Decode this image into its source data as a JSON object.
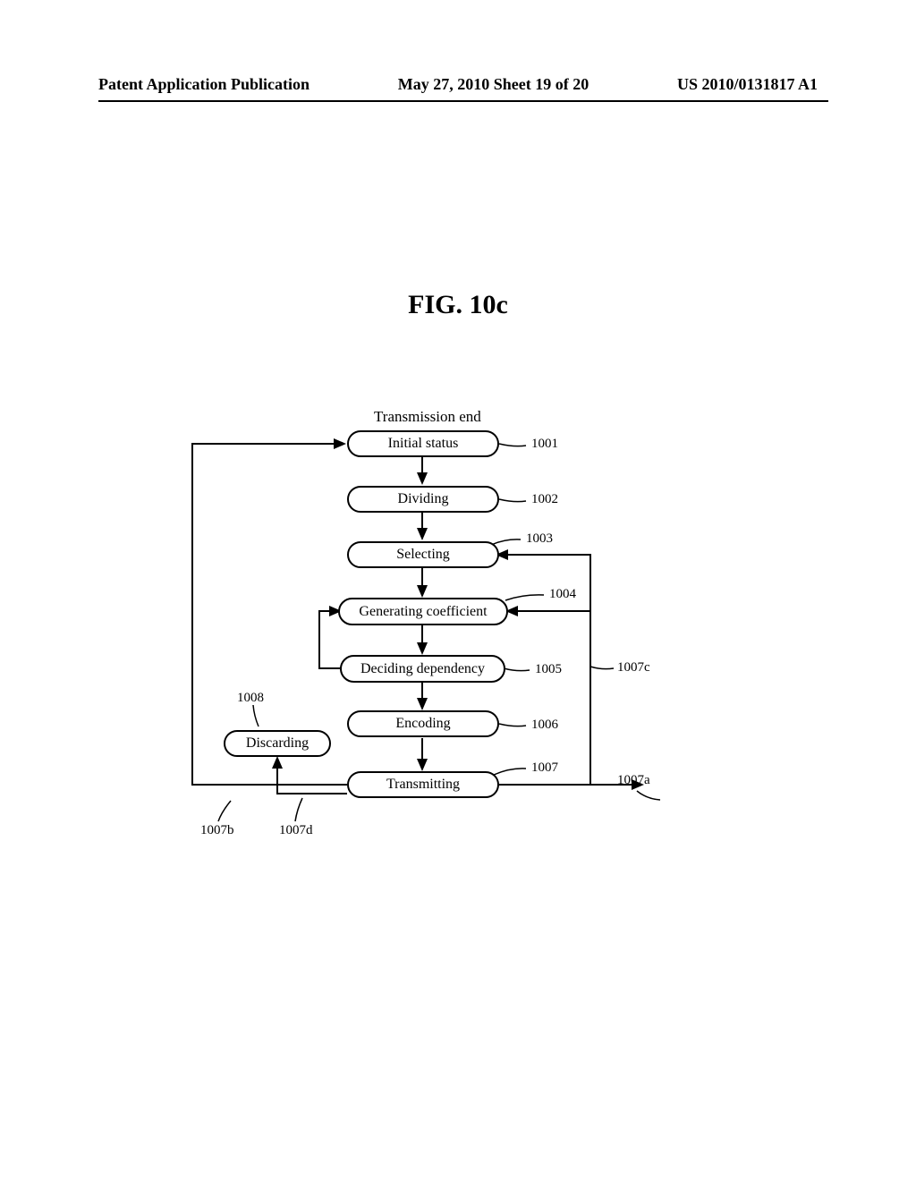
{
  "header": {
    "left": "Patent Application Publication",
    "center": "May 27, 2010  Sheet 19 of 20",
    "right": "US 2010/0131817 A1"
  },
  "figure_title": "FIG. 10c",
  "subtitle": "Transmission end",
  "nodes": {
    "initial_status": "Initial status",
    "dividing": "Dividing",
    "selecting": "Selecting",
    "generating_coefficient": "Generating coefficient",
    "deciding_dependency": "Deciding dependency",
    "encoding": "Encoding",
    "transmitting": "Transmitting",
    "discarding": "Discarding"
  },
  "ref_labels": {
    "r1001": "1001",
    "r1002": "1002",
    "r1003": "1003",
    "r1004": "1004",
    "r1005": "1005",
    "r1006": "1006",
    "r1007": "1007",
    "r1007a": "1007a",
    "r1007b": "1007b",
    "r1007c": "1007c",
    "r1007d": "1007d",
    "r1008": "1008"
  }
}
